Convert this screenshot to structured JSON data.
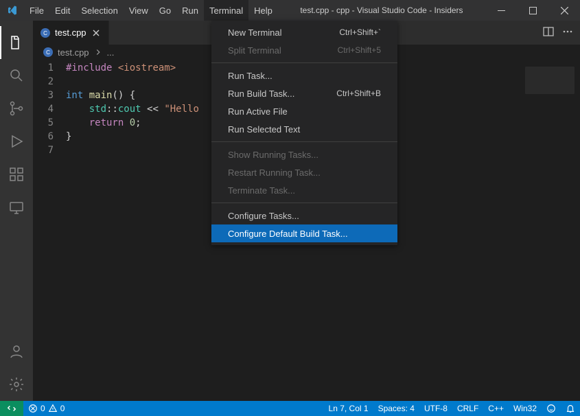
{
  "title": "test.cpp - cpp - Visual Studio Code - Insiders",
  "menubar": [
    "File",
    "Edit",
    "Selection",
    "View",
    "Go",
    "Run",
    "Terminal",
    "Help"
  ],
  "open_menu_index": 6,
  "tab": {
    "filename": "test.cpp"
  },
  "breadcrumb": {
    "filename": "test.cpp",
    "more": "..."
  },
  "code": {
    "lines": [
      {
        "n": 1,
        "html": "<span class='inc'>#include</span> <span class='str'>&lt;iostream&gt;</span>"
      },
      {
        "n": 2,
        "html": ""
      },
      {
        "n": 3,
        "html": "<span class='kw'>int</span> <span class='fn'>main</span><span class='op'>() {</span>"
      },
      {
        "n": 4,
        "html": "    <span class='ty'>std</span><span class='op'>::</span><span class='ty'>cout</span> <span class='op'>&lt;&lt;</span> <span class='str'>\"Hello</span>"
      },
      {
        "n": 5,
        "html": "    <span class='inc'>return</span> <span class='num'>0</span><span class='op'>;</span>"
      },
      {
        "n": 6,
        "html": "<span class='op'>}</span>"
      },
      {
        "n": 7,
        "html": ""
      }
    ]
  },
  "dropdown": {
    "groups": [
      [
        {
          "label": "New Terminal",
          "shortcut": "Ctrl+Shift+`",
          "enabled": true
        },
        {
          "label": "Split Terminal",
          "shortcut": "Ctrl+Shift+5",
          "enabled": false
        }
      ],
      [
        {
          "label": "Run Task...",
          "enabled": true
        },
        {
          "label": "Run Build Task...",
          "shortcut": "Ctrl+Shift+B",
          "enabled": true
        },
        {
          "label": "Run Active File",
          "enabled": true
        },
        {
          "label": "Run Selected Text",
          "enabled": true
        }
      ],
      [
        {
          "label": "Show Running Tasks...",
          "enabled": false
        },
        {
          "label": "Restart Running Task...",
          "enabled": false
        },
        {
          "label": "Terminate Task...",
          "enabled": false
        }
      ],
      [
        {
          "label": "Configure Tasks...",
          "enabled": true
        },
        {
          "label": "Configure Default Build Task...",
          "enabled": true,
          "highlight": true
        }
      ]
    ]
  },
  "statusbar": {
    "errors": "0",
    "warnings": "0",
    "line_col": "Ln 7, Col 1",
    "spaces": "Spaces: 4",
    "encoding": "UTF-8",
    "eol": "CRLF",
    "lang": "C++",
    "target": "Win32"
  },
  "colors": {
    "accent": "#007acc"
  }
}
